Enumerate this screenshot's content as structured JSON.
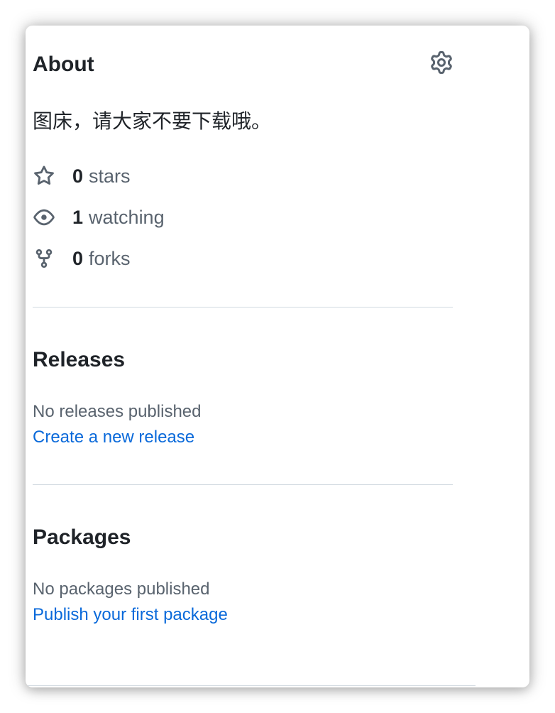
{
  "colors": {
    "text_primary": "#1f2328",
    "text_muted": "#59636e",
    "link": "#0969da",
    "divider": "#d1d9e0"
  },
  "about": {
    "title": "About",
    "settings_icon": "gear-icon",
    "description": "图床，请大家不要下载哦。",
    "stats": [
      {
        "icon": "star-icon",
        "count": "0",
        "label": "stars"
      },
      {
        "icon": "eye-icon",
        "count": "1",
        "label": "watching"
      },
      {
        "icon": "fork-icon",
        "count": "0",
        "label": "forks"
      }
    ]
  },
  "releases": {
    "title": "Releases",
    "empty_text": "No releases published",
    "link_text": "Create a new release"
  },
  "packages": {
    "title": "Packages",
    "empty_text": "No packages published",
    "link_text": "Publish your first package"
  }
}
